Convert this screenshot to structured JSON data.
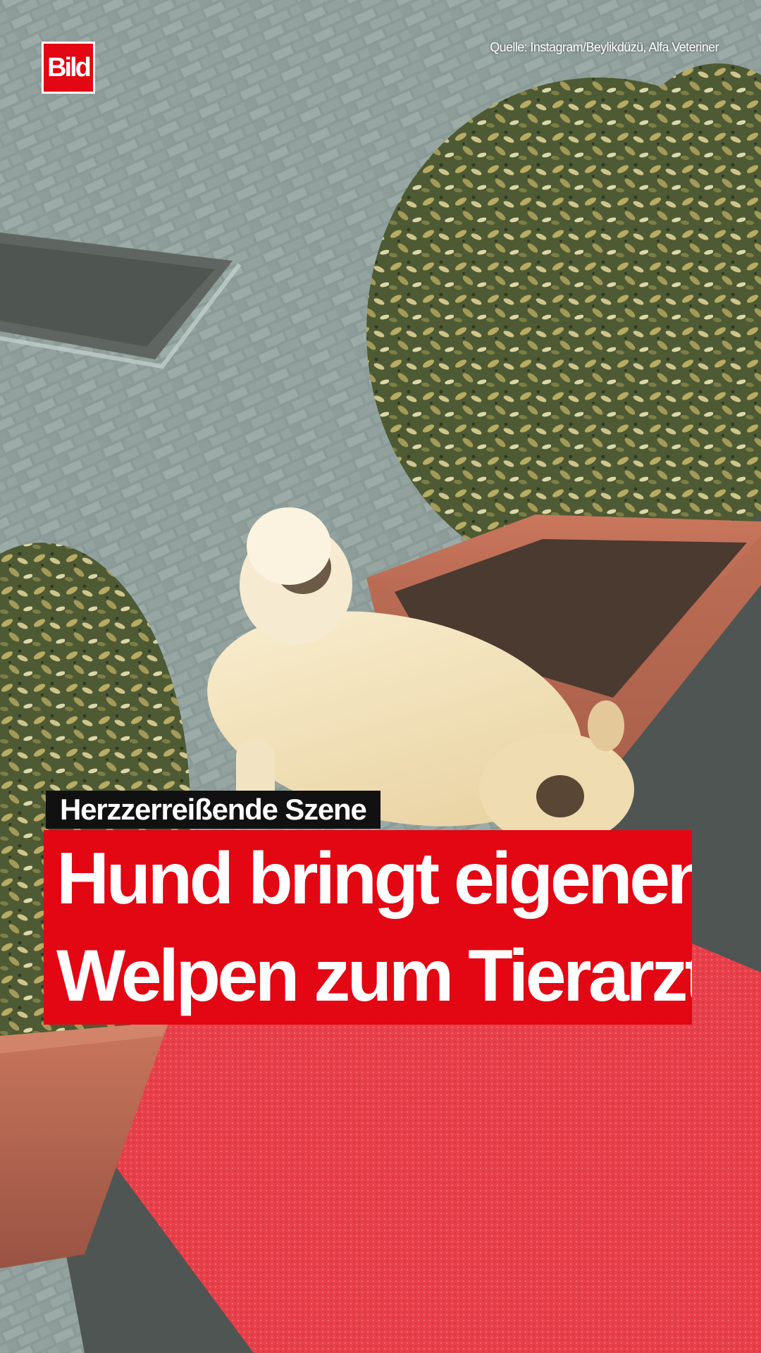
{
  "brand": {
    "logo_text": "Bild",
    "accent_color": "#e30613"
  },
  "source_credit": "Quelle: Instagram/Beylikdüzü, Alfa Veteriner",
  "kicker": "Herzzerreißende Szene",
  "headline": {
    "line1": "Hund bringt eigenen",
    "line2": "Welpen zum Tierarzt"
  },
  "colors": {
    "kicker_background": "#111111",
    "headline_background": "#e30613",
    "headline_text": "#ffffff",
    "carpet": "#e8404a"
  }
}
